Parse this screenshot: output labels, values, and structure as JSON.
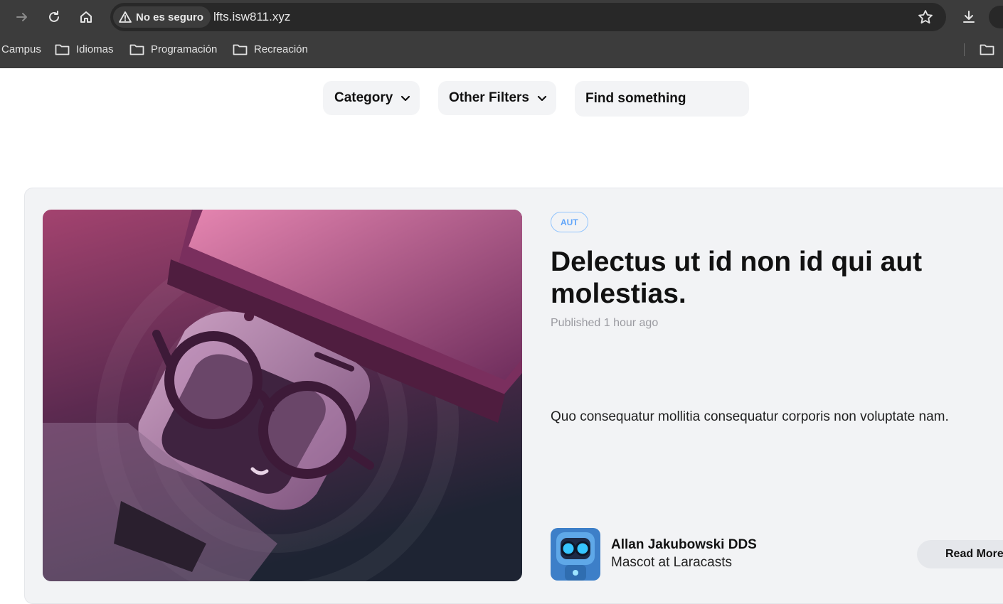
{
  "browser": {
    "security_label": "No es seguro",
    "url": "lfts.isw811.xyz",
    "bookmarks": [
      {
        "label": "Campus"
      },
      {
        "label": "Idiomas"
      },
      {
        "label": "Programación"
      },
      {
        "label": "Recreación"
      }
    ]
  },
  "filters": {
    "category_label": "Category",
    "other_filters_label": "Other Filters",
    "search_placeholder": "Find something"
  },
  "post": {
    "category_badge": "AUT",
    "title": "Delectus ut id non id qui aut molestias.",
    "published": "Published 1 hour ago",
    "excerpt": "Quo consequatur mollitia consequatur corporis non voluptate nam.",
    "author_name": "Allan Jakubowski DDS",
    "author_role": "Mascot at Laracasts",
    "read_more_label": "Read More"
  }
}
